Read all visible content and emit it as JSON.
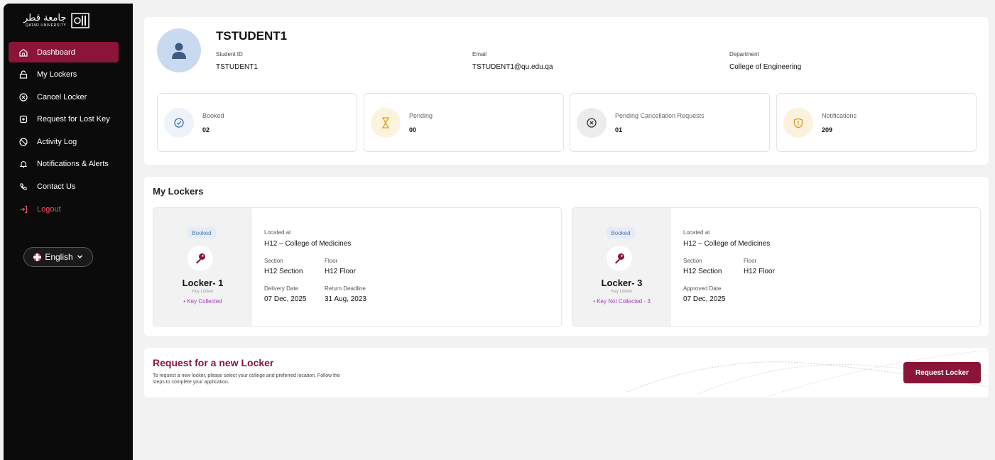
{
  "logo": {
    "arabic": "جامعة قطر",
    "english": "QATAR UNIVERSITY"
  },
  "sidebar": {
    "items": [
      {
        "label": "Dashboard",
        "icon": "home-icon"
      },
      {
        "label": "My Lockers",
        "icon": "lock-icon"
      },
      {
        "label": "Cancel Locker",
        "icon": "cancel-circle-icon"
      },
      {
        "label": "Request for Lost Key",
        "icon": "key-request-icon"
      },
      {
        "label": "Activity Log",
        "icon": "activity-icon"
      },
      {
        "label": "Notifications & Alerts",
        "icon": "bell-icon"
      },
      {
        "label": "Contact Us",
        "icon": "phone-icon"
      },
      {
        "label": "Logout",
        "icon": "logout-icon"
      }
    ],
    "active": "Dashboard"
  },
  "language": {
    "label": "English"
  },
  "profile": {
    "name": "TSTUDENT1",
    "student_id_label": "Student ID",
    "student_id": "TSTUDENT1",
    "email_label": "Email",
    "email": "TSTUDENT1@qu.edu.qa",
    "department_label": "Department",
    "department": "College of Engineering"
  },
  "stats": [
    {
      "label": "Booked",
      "value": "02",
      "icon": "check-circle-icon",
      "color": "#3a6ea5"
    },
    {
      "label": "Pending",
      "value": "00",
      "icon": "hourglass-icon",
      "color": "#d9a520"
    },
    {
      "label": "Pending Cancellation Requests",
      "value": "01",
      "icon": "x-circle-icon",
      "color": "#333333"
    },
    {
      "label": "Notifications",
      "value": "209",
      "icon": "shield-alert-icon",
      "color": "#d99a20"
    }
  ],
  "my_lockers": {
    "title": "My Lockers",
    "lockers": [
      {
        "badge": "Booked",
        "name": "Locker- 1",
        "type": "Key Locker",
        "status": "• Key Collected",
        "located_label": "Located at",
        "located": "H12 – College of Medicines",
        "section_label": "Section",
        "section": "H12 Section",
        "floor_label": "Floor",
        "floor": "H12 Floor",
        "date1_label": "Delivery Date",
        "date1": "07 Dec, 2025",
        "date2_label": "Return Deadline",
        "date2": "31 Aug, 2023"
      },
      {
        "badge": "Booked",
        "name": "Locker- 3",
        "type": "Key Locker",
        "status": "• Key Not Collected - 3",
        "located_label": "Located at",
        "located": "H12 – College of Medicines",
        "section_label": "Section",
        "section": "H12 Section",
        "floor_label": "Floor",
        "floor": "H12 Floor",
        "date1_label": "Approved Date",
        "date1": "07 Dec, 2025"
      }
    ]
  },
  "request": {
    "title": "Request for a new Locker",
    "description": "To request a new locker, please select your college and preferred location. Follow the steps to complete your application.",
    "button": "Request Locker"
  },
  "colors": {
    "brand": "#8a1538",
    "sidebar": "#0b0b0b"
  }
}
